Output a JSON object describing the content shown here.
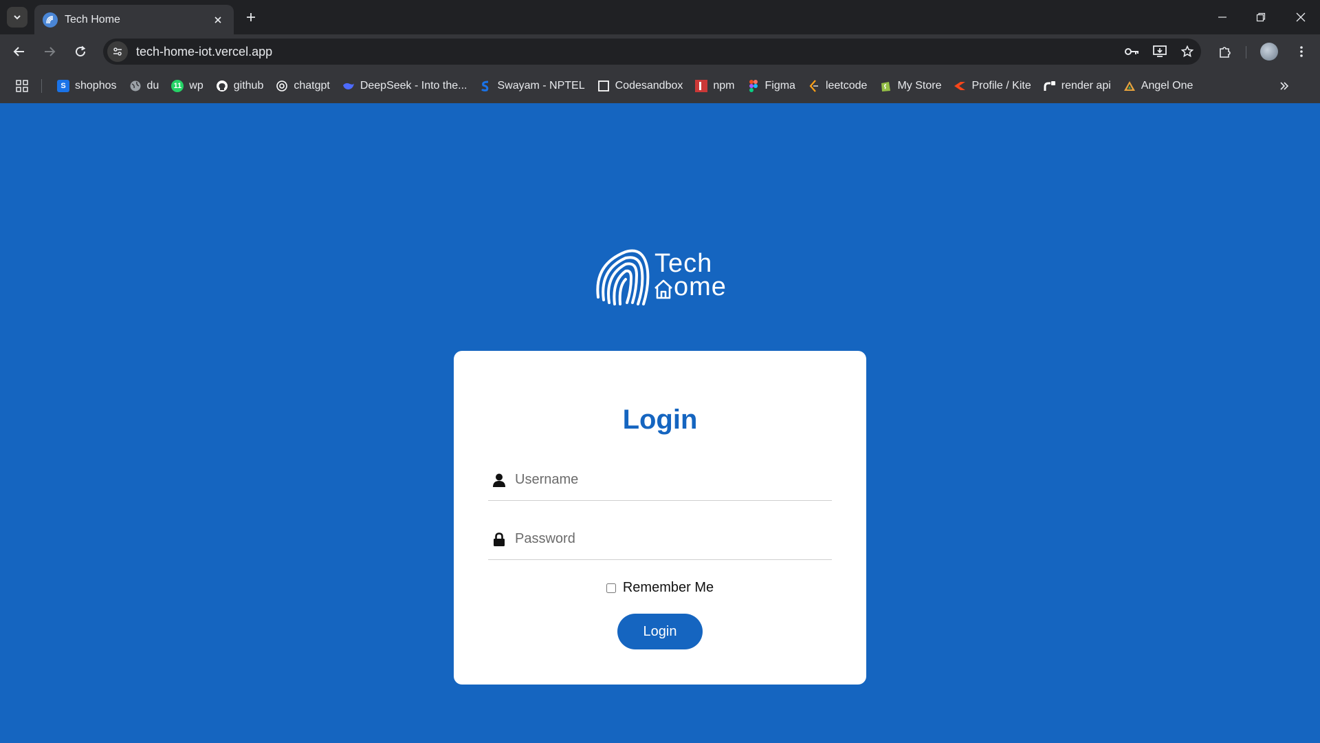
{
  "browser": {
    "tab_title": "Tech Home",
    "url": "tech-home-iot.vercel.app",
    "bookmarks": [
      {
        "label": "shophos",
        "icon": "sophos-icon",
        "color": "#1a73e8"
      },
      {
        "label": "du",
        "icon": "globe-icon",
        "color": "#9aa0a6"
      },
      {
        "label": "wp",
        "icon": "whatsapp-icon",
        "color": "#25d366"
      },
      {
        "label": "github",
        "icon": "github-icon",
        "color": "#ffffff"
      },
      {
        "label": "chatgpt",
        "icon": "chatgpt-icon",
        "color": "#ffffff"
      },
      {
        "label": "DeepSeek - Into the...",
        "icon": "deepseek-icon",
        "color": "#4d6bfe"
      },
      {
        "label": "Swayam - NPTEL",
        "icon": "swayam-icon",
        "color": "#1a73e8"
      },
      {
        "label": "Codesandbox",
        "icon": "codesandbox-icon",
        "color": "#ffffff"
      },
      {
        "label": "npm",
        "icon": "npm-icon",
        "color": "#cb3837"
      },
      {
        "label": "Figma",
        "icon": "figma-icon",
        "color": "#f24e1e"
      },
      {
        "label": "leetcode",
        "icon": "leetcode-icon",
        "color": "#ffa116"
      },
      {
        "label": "My Store",
        "icon": "shopify-icon",
        "color": "#95bf47"
      },
      {
        "label": "Profile / Kite",
        "icon": "kite-icon",
        "color": "#f6461a"
      },
      {
        "label": "render api",
        "icon": "render-icon",
        "color": "#ffffff"
      },
      {
        "label": "Angel One",
        "icon": "angelone-icon",
        "color": "#e8a33d"
      }
    ]
  },
  "logo": {
    "line1": "Tech",
    "line2": "ome"
  },
  "login": {
    "title": "Login",
    "username_placeholder": "Username",
    "password_placeholder": "Password",
    "remember_label": "Remember Me",
    "remember_checked": false,
    "button_label": "Login"
  },
  "colors": {
    "page_background": "#1565c0",
    "accent": "#1565c0",
    "card": "#ffffff"
  }
}
